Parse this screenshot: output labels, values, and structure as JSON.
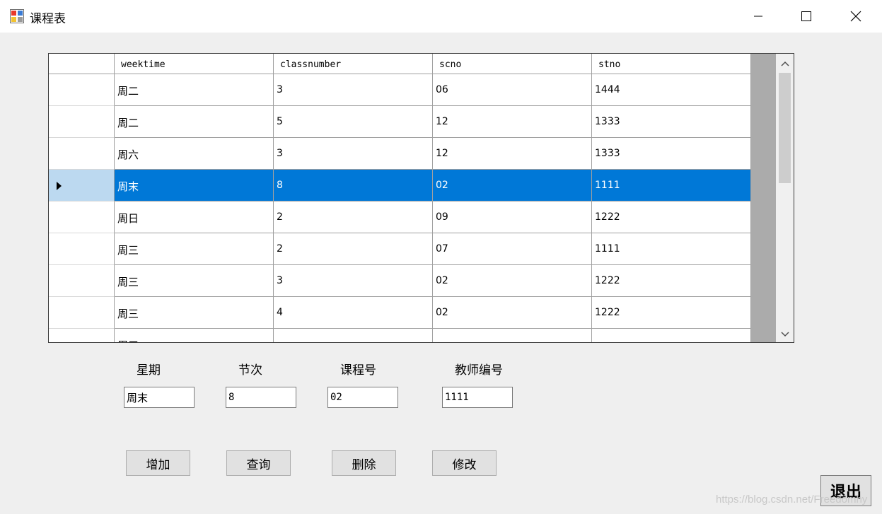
{
  "window": {
    "title": "课程表",
    "icon": "app-form-icon",
    "controls": [
      "minimize-icon",
      "maximize-icon",
      "close-icon"
    ]
  },
  "grid": {
    "columns": [
      "weektime",
      "classnumber",
      "scno",
      "stno"
    ],
    "rows": [
      [
        "周二",
        "3",
        "06",
        "1444"
      ],
      [
        "周二",
        "5",
        "12",
        "1333"
      ],
      [
        "周六",
        "3",
        "12",
        "1333"
      ],
      [
        "周末",
        "8",
        "02",
        "1111"
      ],
      [
        "周日",
        "2",
        "09",
        "1222"
      ],
      [
        "周三",
        "2",
        "07",
        "1111"
      ],
      [
        "周三",
        "3",
        "02",
        "1222"
      ],
      [
        "周三",
        "4",
        "02",
        "1222"
      ]
    ],
    "selected_row": 3,
    "partial_row_first_cell": "周三"
  },
  "form": {
    "labels": {
      "weekday": "星期",
      "period": "节次",
      "course_no": "课程号",
      "teacher_no": "教师编号"
    },
    "values": {
      "weekday": "周末",
      "period": "8",
      "course_no": "02",
      "teacher_no": "1111"
    }
  },
  "buttons": {
    "add": "增加",
    "query": "查询",
    "delete": "删除",
    "edit": "修改",
    "exit": "退出"
  },
  "watermark": "https://blog.csdn.net/Freedomhy"
}
